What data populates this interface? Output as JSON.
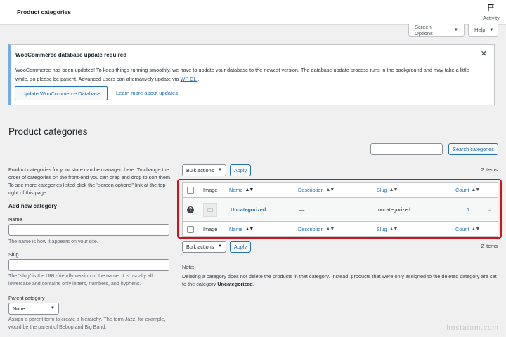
{
  "topbar": {
    "title": "Product categories",
    "activity_label": "Activity"
  },
  "screen_meta": {
    "screen_options_label": "Screen Options",
    "help_label": "Help"
  },
  "notice": {
    "title": "WooCommerce database update required",
    "text_line1": "WooCommerce has been updated! To keep things running smoothly, we have to update your database to the newest version. The database update process runs in the background and may take a little",
    "text_line2": "while, so please be patient. Advanced users can alternatively update via ",
    "text_link": "WP CLI",
    "text_end": ".",
    "update_button": "Update WooCommerce Database",
    "learn_more": "Learn more about updates"
  },
  "page": {
    "title": "Product categories"
  },
  "search": {
    "button_label": "Search categories",
    "value": ""
  },
  "intro": "Product categories for your store can be managed here. To change the order of categories on the front-end you can drag and drop to sort them. To see more categories listed click the \"screen options\" link at the top-right of this page.",
  "form": {
    "title": "Add new category",
    "name_label": "Name",
    "name_value": "",
    "name_desc": "The name is how it appears on your site.",
    "slug_label": "Slug",
    "slug_value": "",
    "slug_desc": "The \"slug\" is the URL-friendly version of the name. It is usually all lowercase and contains only letters, numbers, and hyphens.",
    "parent_label": "Parent category",
    "parent_value": "None",
    "parent_desc": "Assign a parent term to create a hierarchy. The term Jazz, for example, would be the parent of Bebop and Big Band."
  },
  "table_nav": {
    "bulk_label": "Bulk actions",
    "apply_label": "Apply",
    "count": "2 items"
  },
  "table": {
    "columns": {
      "image": "Image",
      "name": "Name",
      "description": "Description",
      "slug": "Slug",
      "count": "Count"
    },
    "rows": [
      {
        "name": "Uncategorized",
        "description": "—",
        "slug": "uncategorized",
        "count": "1"
      }
    ]
  },
  "note": {
    "label": "Note:",
    "text": "Deleting a category does not delete the products in that category. Instead, products that were only assigned to the deleted category are set to the category ",
    "category": "Uncategorized",
    "end": "."
  },
  "watermark": "hostatom.com",
  "colors": {
    "link": "#2271b1",
    "highlight": "#d0121b",
    "notice_border": "#72aee6"
  }
}
